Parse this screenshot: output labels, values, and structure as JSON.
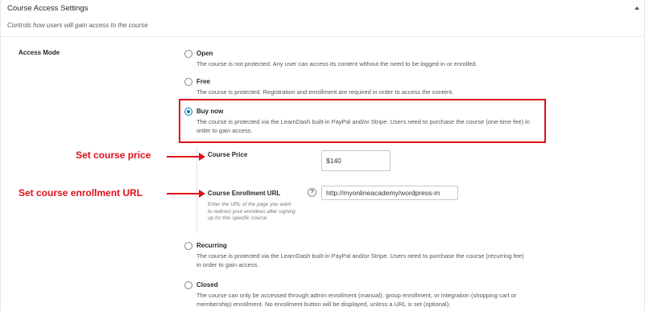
{
  "panel": {
    "title": "Course Access Settings",
    "subtitle": "Controls how users will gain access to the course",
    "collapse_icon": "triangle-up-icon"
  },
  "access_mode": {
    "label": "Access Mode",
    "options": [
      {
        "title": "Open",
        "desc": "The course is not protected. Any user can access its content without the need to be logged-in or enrolled.",
        "checked": false
      },
      {
        "title": "Free",
        "desc": "The course is protected. Registration and enrollment are required in order to access the content.",
        "checked": false
      },
      {
        "title": "Buy now",
        "desc": "The course is protected via the LearnDash built-in PayPal and/or Stripe. Users need to purchase the course (one-time fee) in order to gain access.",
        "checked": true
      },
      {
        "title": "Recurring",
        "desc": "The course is protected via the LearnDash built-in PayPal and/or Stripe. Users need to purchase the course (recurring fee) in order to gain access.",
        "checked": false
      },
      {
        "title": "Closed",
        "desc": "The course can only be accessed through admin enrollment (manual), group enrollment, or integration (shopping cart or membership) enrollment. No enrollment button will be displayed, unless a URL is set (optional).",
        "checked": false
      }
    ]
  },
  "buy_now_settings": {
    "price_label": "Course Price",
    "price_value": "$140",
    "url_label": "Course Enrollment URL",
    "url_help": "Enter the URL of the page you want to redirect your enrollees after signing up for this specific course",
    "url_value": "http://myonlineacademy/wordpress-m",
    "help_icon": "question-icon",
    "help_glyph": "?"
  },
  "annotations": {
    "price": "Set course price",
    "url": "Set course enrollment URL"
  },
  "colors": {
    "highlight": "#e0101a",
    "radio_accent": "#007cba"
  }
}
